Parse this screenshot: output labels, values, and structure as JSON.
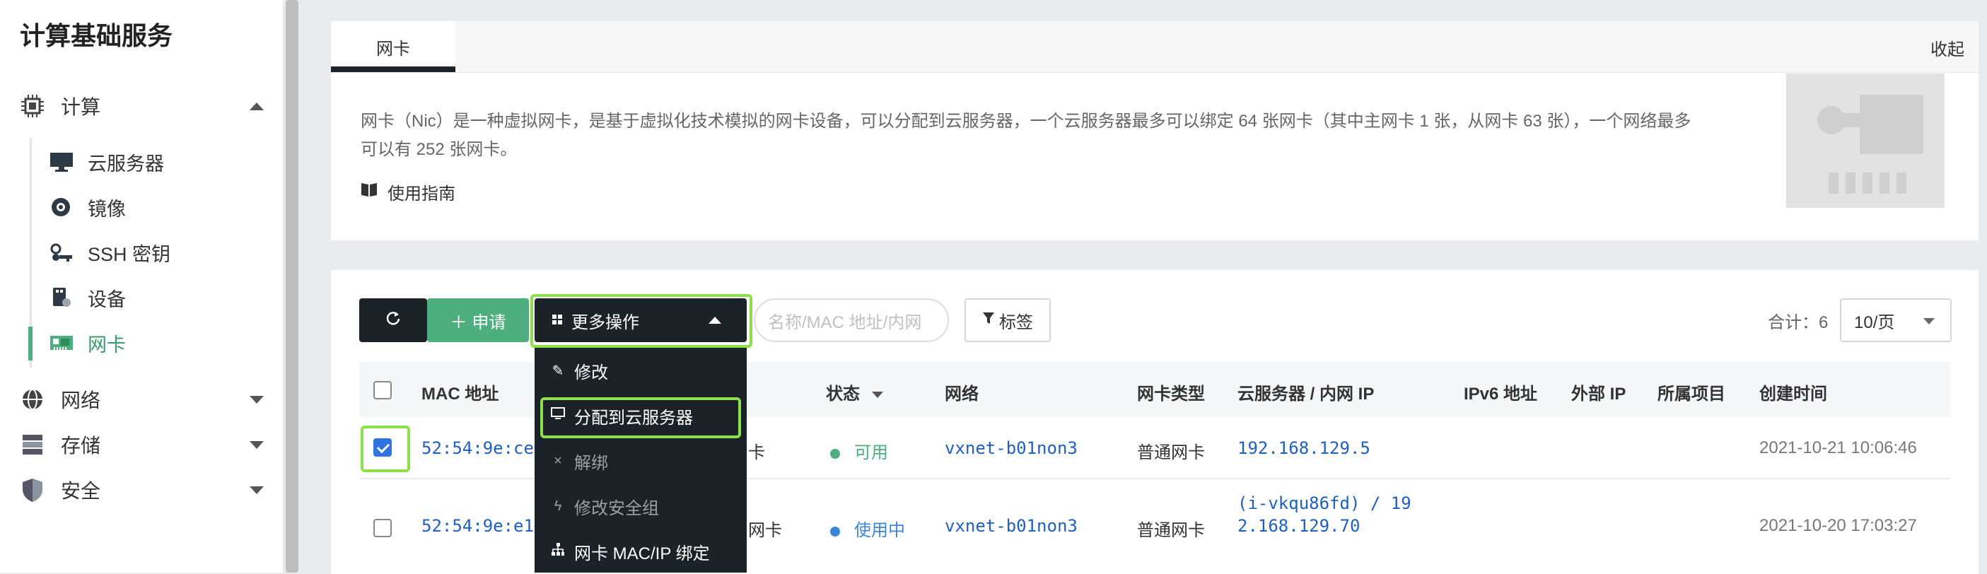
{
  "sidebar": {
    "title": "计算基础服务",
    "groups": [
      {
        "label": "计算",
        "icon": "chip-icon",
        "expanded": true
      },
      {
        "label": "网络",
        "icon": "network-icon",
        "expanded": false
      },
      {
        "label": "存储",
        "icon": "storage-icon",
        "expanded": false
      },
      {
        "label": "安全",
        "icon": "shield-icon",
        "expanded": false
      }
    ],
    "items": [
      {
        "label": "云服务器",
        "icon": "monitor-icon"
      },
      {
        "label": "镜像",
        "icon": "disc-icon"
      },
      {
        "label": "SSH 密钥",
        "icon": "key-icon"
      },
      {
        "label": "设备",
        "icon": "usb-device-icon"
      },
      {
        "label": "网卡",
        "icon": "nic-icon",
        "active": true
      }
    ]
  },
  "info_card": {
    "tab": "网卡",
    "collapse": "收起",
    "description": "网卡（Nic）是一种虚拟网卡，是基于虚拟化技术模拟的网卡设备，可以分配到云服务器，一个云服务器最多可以绑定 64 张网卡（其中主网卡 1 张，从网卡 63 张），一个网络最多可以有 252 张网卡。",
    "guide": "使用指南"
  },
  "toolbar": {
    "apply": "＋ 申请",
    "more": "更多操作",
    "search_placeholder": "名称/MAC 地址/内网",
    "tag": "标签",
    "total": "合计：6",
    "page_size": "10/页"
  },
  "dropdown": {
    "items": [
      {
        "label": "修改",
        "icon": "pencil-icon",
        "disabled": false
      },
      {
        "label": "分配到云服务器",
        "icon": "monitor-icon",
        "disabled": false
      },
      {
        "label": "解绑",
        "icon": "x-icon",
        "disabled": true
      },
      {
        "label": "修改安全组",
        "icon": "bolt-icon",
        "disabled": true
      },
      {
        "label": "网卡 MAC/IP 绑定",
        "icon": "tree-icon",
        "disabled": false
      }
    ]
  },
  "table": {
    "headers": {
      "mac": "MAC 地址",
      "status": "状态",
      "network": "网络",
      "type": "网卡类型",
      "server_ip": "云服务器 / 内网 IP",
      "ipv6": "IPv6 地址",
      "public_ip": "外部 IP",
      "project": "所属项目",
      "created": "创建时间"
    },
    "rows": [
      {
        "checked": true,
        "mac": "52:54:9e:ce",
        "name_tail": "卡",
        "status": "可用",
        "status_color": "#4caf7d",
        "network": "vxnet-b01non3",
        "type": "普通网卡",
        "server_line1": "192.168.129.5",
        "server_line2": "",
        "created": "2021-10-21 10:06:46"
      },
      {
        "checked": false,
        "mac": "52:54:9e:e1",
        "name_tail": "网卡",
        "status": "使用中",
        "status_color": "#3b86d6",
        "network": "vxnet-b01non3",
        "type": "普通网卡",
        "server_line1": "(i-vkqu86fd) / 19",
        "server_line2": "2.168.129.70",
        "created": "2021-10-20 17:03:27"
      }
    ]
  },
  "colors": {
    "primary_dark": "#1b2329",
    "accent_green": "#4caf7d",
    "highlight": "#8ee04a",
    "link_blue": "#1f5fc2"
  }
}
